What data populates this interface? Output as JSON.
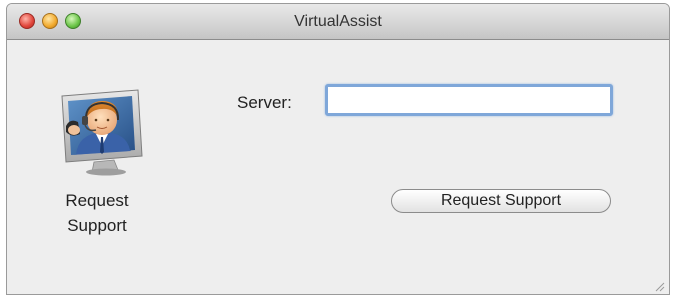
{
  "window": {
    "title": "VirtualAssist"
  },
  "sidebar": {
    "icon": "support-agent-icon",
    "label_line1": "Request",
    "label_line2": "Support"
  },
  "form": {
    "server_label": "Server:",
    "server_value": "",
    "server_placeholder": ""
  },
  "actions": {
    "request_support_label": "Request Support"
  },
  "colors": {
    "focus_ring": "#7fa7d9",
    "window_background": "#eeeeee",
    "titlebar_top": "#e9e9e9",
    "titlebar_bottom": "#c5c5c5"
  }
}
